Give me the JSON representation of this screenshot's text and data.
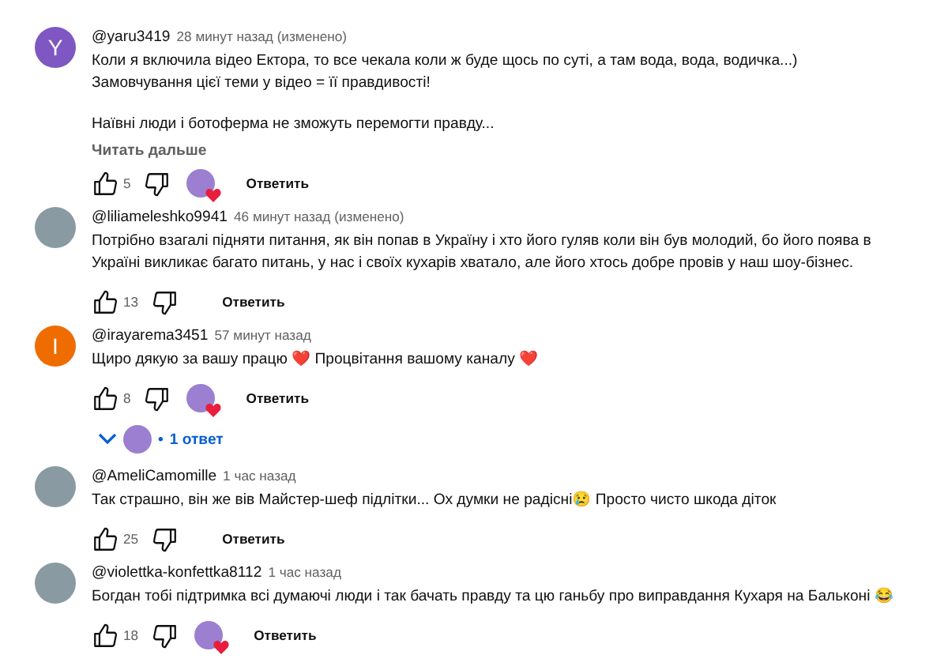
{
  "comments": [
    {
      "author": "@yaru3419",
      "time": "28 минут назад",
      "edited": "(изменено)",
      "avatar": {
        "kind": "letter",
        "letter": "Y",
        "color": "#7e57c2"
      },
      "paragraphs": [
        "Коли я включила відео Ектора, то все чекала коли ж буде щось по суті, а там вода, вода, водичка...)\nЗамовчування цієї теми у відео = її правдивості!",
        "Наївні люди і ботоферма не зможуть перемогти правду..."
      ],
      "read_more": "Читать дальше",
      "likes": "5",
      "creator_heart": true,
      "reply": "Ответить"
    },
    {
      "author": "@liliameleshko9941",
      "time": "46 минут назад",
      "edited": "(изменено)",
      "avatar": {
        "kind": "photo"
      },
      "paragraphs": [
        "Потрібно взагалі підняти питання, як він попав в Україну і хто його гуляв коли він був молодий, бо його поява в Україні викликає багато питань, у нас і своїх кухарів хватало, але його хтось добре провів у наш шоу-бізнес."
      ],
      "likes": "13",
      "creator_heart": false,
      "reply": "Ответить"
    },
    {
      "author": "@irayarema3451",
      "time": "57 минут назад",
      "avatar": {
        "kind": "letter",
        "letter": "I",
        "color": "#ef6c00"
      },
      "paragraphs": [
        "Щиро дякую за вашу працю ❤️  Процвітання вашому каналу ❤️"
      ],
      "likes": "8",
      "creator_heart": true,
      "reply": "Ответить",
      "replies": {
        "label": "1 ответ",
        "separator": "•",
        "expanded": false
      }
    },
    {
      "author": "@AmeliCamomille",
      "time": "1 час назад",
      "avatar": {
        "kind": "photo"
      },
      "paragraphs": [
        "Так страшно, він же вів Майстер-шеф підлітки... Ох думки не радісні😢  Просто чисто шкода діток"
      ],
      "likes": "25",
      "creator_heart": false,
      "reply": "Ответить"
    },
    {
      "author": "@violettka-konfettka8112",
      "time": "1 час назад",
      "avatar": {
        "kind": "photo"
      },
      "paragraphs": [
        "Богдан тобі підтримка всі думаючі люди і так бачать правду та цю ганьбу про виправдання Кухаря на Бальконі 😂"
      ],
      "likes": "18",
      "creator_heart": true,
      "reply": "Ответить"
    }
  ]
}
